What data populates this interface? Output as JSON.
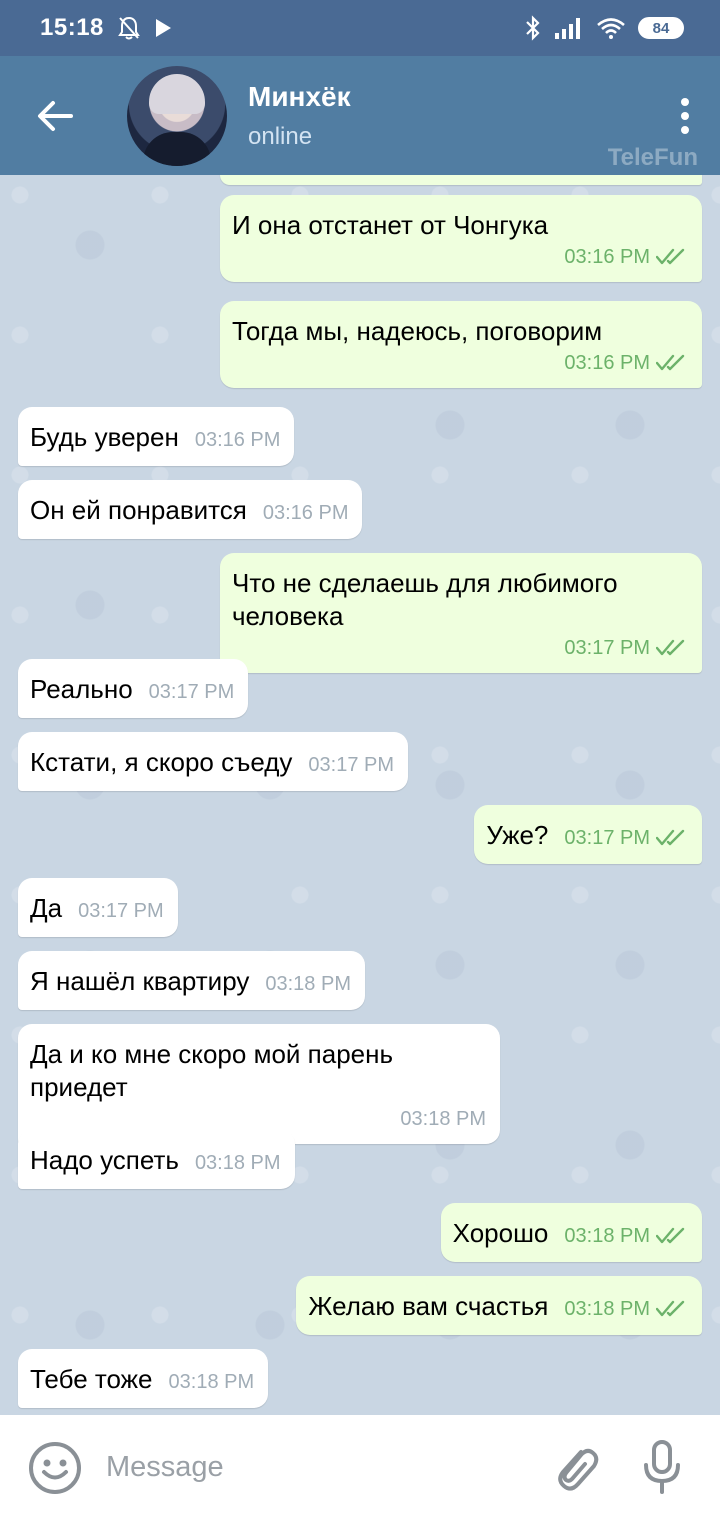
{
  "status_bar": {
    "time": "15:18",
    "battery": "84"
  },
  "header": {
    "contact_name": "Минхёк",
    "contact_status": "online",
    "watermark": "TeleFun"
  },
  "messages": [
    {
      "direction": "out",
      "text": "И она отстанет от Чонгука",
      "time": "03:16 PM",
      "read": true
    },
    {
      "direction": "out",
      "text": "Тогда мы, надеюсь, поговорим",
      "time": "03:16 PM",
      "read": true
    },
    {
      "direction": "in",
      "text": "Будь уверен",
      "time": "03:16 PM"
    },
    {
      "direction": "in",
      "text": "Он ей понравится",
      "time": "03:16 PM"
    },
    {
      "direction": "out",
      "text": "Что не сделаешь для любимого человека",
      "time": "03:17 PM",
      "read": true
    },
    {
      "direction": "in",
      "text": "Реально",
      "time": "03:17 PM"
    },
    {
      "direction": "in",
      "text": "Кстати, я скоро съеду",
      "time": "03:17 PM"
    },
    {
      "direction": "out",
      "text": "Уже?",
      "time": "03:17 PM",
      "read": true
    },
    {
      "direction": "in",
      "text": "Да",
      "time": "03:17 PM"
    },
    {
      "direction": "in",
      "text": "Я нашёл квартиру",
      "time": "03:18 PM"
    },
    {
      "direction": "in",
      "text": "Да и ко мне скоро мой парень приедет",
      "time": "03:18 PM"
    },
    {
      "direction": "in",
      "text": "Надо успеть",
      "time": "03:18 PM"
    },
    {
      "direction": "out",
      "text": "Хорошо",
      "time": "03:18 PM",
      "read": true
    },
    {
      "direction": "out",
      "text": "Желаю вам счастья",
      "time": "03:18 PM",
      "read": true
    },
    {
      "direction": "in",
      "text": "Тебе тоже",
      "time": "03:18 PM"
    }
  ],
  "input": {
    "placeholder": "Message"
  },
  "colors": {
    "header": "#517da2",
    "status_bar": "#4a6a94",
    "outgoing_bubble": "#efffde",
    "incoming_bubble": "#ffffff",
    "read_check": "#6cb26a"
  }
}
